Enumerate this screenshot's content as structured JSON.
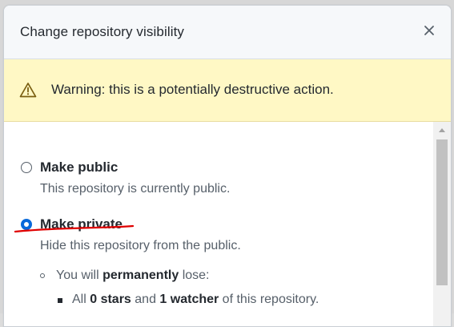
{
  "dialog": {
    "title": "Change repository visibility",
    "close_icon": "close-icon"
  },
  "warning": {
    "icon": "alert-triangle-icon",
    "text": "Warning: this is a potentially destructive action."
  },
  "options": {
    "public": {
      "label": "Make public",
      "description": "This repository is currently public.",
      "selected": false
    },
    "private": {
      "label": "Make private",
      "description": "Hide this repository from the public.",
      "selected": true
    }
  },
  "consequences": {
    "lose_prefix": "You will ",
    "lose_bold": "permanently",
    "lose_suffix": " lose:",
    "stars_prefix": "All ",
    "stars_count": "0 stars",
    "stars_mid": " and ",
    "watcher_count": "1 watcher",
    "stars_suffix": " of this repository."
  },
  "colors": {
    "accent": "#0969da",
    "warning_bg": "#fff8c5",
    "annotation": "#e00000"
  }
}
